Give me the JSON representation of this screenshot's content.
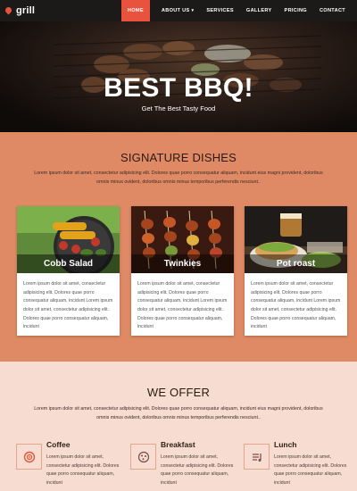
{
  "brand": {
    "name": "grill"
  },
  "nav": {
    "items": [
      {
        "label": "HOME",
        "active": true
      },
      {
        "label": "ABOUT US",
        "has_dropdown": true
      },
      {
        "label": "SERVICES"
      },
      {
        "label": "GALLERY"
      },
      {
        "label": "PRICING"
      },
      {
        "label": "CONTACT"
      }
    ]
  },
  "hero": {
    "title": "BEST BBQ!",
    "subtitle": "Get The Best Tasty Food"
  },
  "signature": {
    "title": "SIGNATURE DISHES",
    "description": "Lorem ipsum dolor sit amet, consectetur adipisicing elit. Dolores quae porro consequatur aliquam, incidunt eius magni provident, doloribus omnis minus ovident, doloribus omnis minus temporibus perferendis nesciunt..",
    "cards": [
      {
        "name": "Cobb Salad",
        "text": "Lorem ipsum dolor sit amet, consectetur adipisicing elit. Dolores quae porro consequatur aliquam, incidunt Lorem ipsum dolor sit amet, consectetur adipisicing elit. Dolores quae porro consequatur aliquam, incidunt"
      },
      {
        "name": "Twinkies",
        "text": "Lorem ipsum dolor sit amet, consectetur adipisicing elit. Dolores quae porro consequatur aliquam, incidunt Lorem ipsum dolor sit amet, consectetur adipisicing elit. Dolores quae porro consequatur aliquam, incidunt"
      },
      {
        "name": "Pot roast",
        "text": "Lorem ipsum dolor sit amet, consectetur adipisicing elit. Dolores quae porro consequatur aliquam, incidunt Lorem ipsum dolor sit amet, consectetur adipisicing elit. Dolores quae porro consequatur aliquam, incidunt"
      }
    ]
  },
  "offer": {
    "title": "WE OFFER",
    "description": "Lorem ipsum dolor sit amet, consectetur adipisicing elit. Dolores quae porro consequatur aliquam, incidunt eius magni provident, doloribus omnis minus ovident, doloribus omnis minus temporibus perferendis nesciunt..",
    "services": [
      {
        "title": "Coffee",
        "icon": "coffee-icon",
        "text": "Lorem ipsum dolor sit amet, consectetur adipisicing elit. Dolores quae porro consequatur aliquam, incidunt"
      },
      {
        "title": "Breakfast",
        "icon": "cookie-icon",
        "text": "Lorem ipsum dolor sit amet, consectetur adipisicing elit. Dolores quae porro consequatur aliquam, incidunt"
      },
      {
        "title": "Lunch",
        "icon": "music-icon",
        "text": "Lorem ipsum dolor sit amet, consectetur adipisicing elit. Dolores quae porro consequatur aliquam, incidunt"
      }
    ]
  },
  "colors": {
    "accent": "#e9523c",
    "signature_bg": "#df8a65",
    "offer_bg": "#f7ddd1",
    "nav_bg": "#1b1a19"
  }
}
